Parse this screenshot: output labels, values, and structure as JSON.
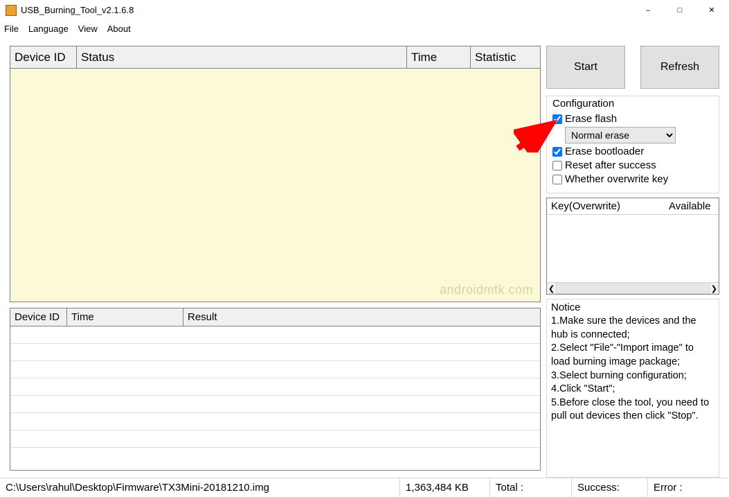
{
  "window": {
    "title": "USB_Burning_Tool_v2.1.6.8"
  },
  "menu": {
    "file": "File",
    "language": "Language",
    "view": "View",
    "about": "About"
  },
  "grid_top": {
    "headers": {
      "device_id": "Device ID",
      "status": "Status",
      "time": "Time",
      "statistic": "Statistic"
    }
  },
  "grid_bottom": {
    "headers": {
      "device_id": "Device ID",
      "time": "Time",
      "result": "Result"
    }
  },
  "actions": {
    "start": "Start",
    "refresh": "Refresh"
  },
  "config": {
    "legend": "Configuration",
    "erase_flash": {
      "label": "Erase flash",
      "checked": true
    },
    "erase_mode": "Normal erase",
    "erase_bootloader": {
      "label": "Erase bootloader",
      "checked": true
    },
    "reset_after": {
      "label": "Reset after success",
      "checked": false
    },
    "overwrite_key": {
      "label": "Whether overwrite key",
      "checked": false
    }
  },
  "key_box": {
    "col1": "Key(Overwrite)",
    "col2": "Available"
  },
  "notice": {
    "title": "Notice",
    "lines": [
      "1.Make sure the devices and the hub is connected;",
      "2.Select \"File\"-\"Import image\" to load burning image package;",
      "3.Select burning configuration;",
      "4.Click \"Start\";",
      "5.Before close the tool, you need to pull out devices then click \"Stop\"."
    ]
  },
  "status": {
    "path": "C:\\Users\\rahul\\Desktop\\Firmware\\TX3Mini-20181210.img",
    "size": "1,363,484 KB",
    "total": "Total :",
    "success": "Success:",
    "error": "Error :"
  },
  "watermark": "androidmtk.com"
}
